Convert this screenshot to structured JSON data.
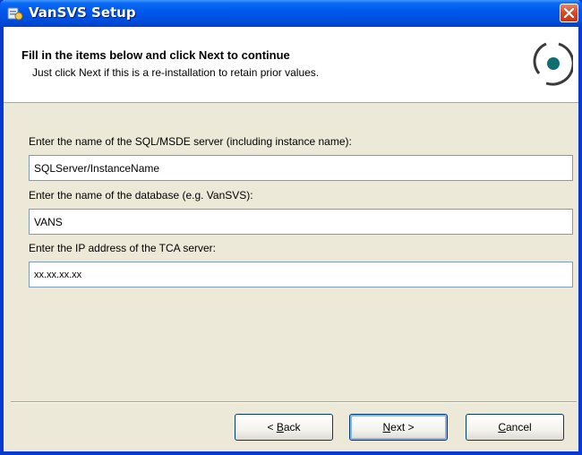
{
  "window": {
    "title": "VanSVS Setup"
  },
  "header": {
    "title": "Fill in the items below and click Next to continue",
    "subtitle": "Just click Next if this is a re-installation to retain prior values."
  },
  "form": {
    "server_label": "Enter the name of the SQL/MSDE server (including instance name):",
    "server_value": "SQLServer/InstanceName",
    "database_label": "Enter the name of the database (e.g. VanSVS):",
    "database_value": "VANS",
    "tca_label": "Enter the IP address of the TCA server:",
    "tca_value": "xx.xx.xx.xx"
  },
  "buttons": {
    "back": {
      "prefix": "< ",
      "mnemonic": "B",
      "rest": "ack"
    },
    "next": {
      "mnemonic": "N",
      "rest": "ext >"
    },
    "cancel": {
      "mnemonic": "C",
      "rest": "ancel"
    }
  },
  "colors": {
    "titlebar": "#0058ee",
    "dialog_bg": "#ece9d8",
    "close": "#d9461f"
  },
  "icons": {
    "title": "setup-app-icon",
    "close": "close-icon",
    "logo": "setup-logo-icon"
  }
}
